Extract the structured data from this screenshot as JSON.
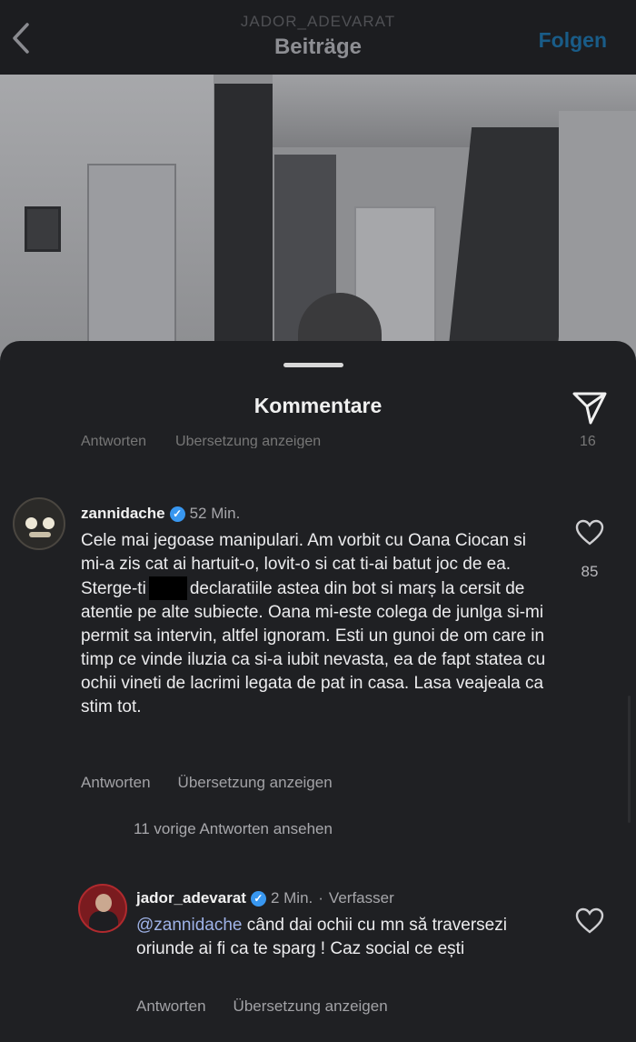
{
  "header": {
    "username": "JADOR_ADEVARAT",
    "title": "Beiträge",
    "follow_label": "Folgen",
    "back_icon": "chevron-left-icon"
  },
  "sheet": {
    "title": "Kommentare",
    "share_icon": "send-icon",
    "cut_row": {
      "reply": "Antworten",
      "translate": "Übersetzung anzeigen",
      "count": "16"
    }
  },
  "comments": [
    {
      "username": "zannidache",
      "verified": true,
      "time": "52 Min.",
      "text_part1": "Cele mai jegoase manipulari. Am vorbit cu Oana Ciocan si mi-a zis cat ai hartuit-o, lovit-o si cat ti-ai batut joc de ea. Sterge-ti",
      "text_part2": "declaratiile astea din bot si marș la cersit de atentie pe alte subiecte. Oana mi-este colega de junlga si-mi permit sa intervin, altfel ignoram. Esti un gunoi de om care in timp ce vinde iluzia ca si-a iubit nevasta, ea de fapt statea cu ochii vineti de lacrimi legata de pat in casa. Lasa veajeala ca stim tot.",
      "reply_label": "Antworten",
      "translate_label": "Übersetzung anzeigen",
      "likes": "85"
    },
    {
      "username": "jador_adevarat",
      "verified": true,
      "time": "2 Min.",
      "author_label": "Verfasser",
      "mention": "@zannidache",
      "text": " când dai ochii cu mn să traversezi oriunde ai fi ca te sparg ! Caz social ce ești",
      "reply_label": "Antworten",
      "translate_label": "Übersetzung anzeigen"
    }
  ],
  "view_more_replies": "11 vorige Antworten ansehen",
  "colors": {
    "background": "#1f2023",
    "verified": "#3897f0",
    "follow": "#195c88",
    "mention": "#9fb3e8"
  }
}
